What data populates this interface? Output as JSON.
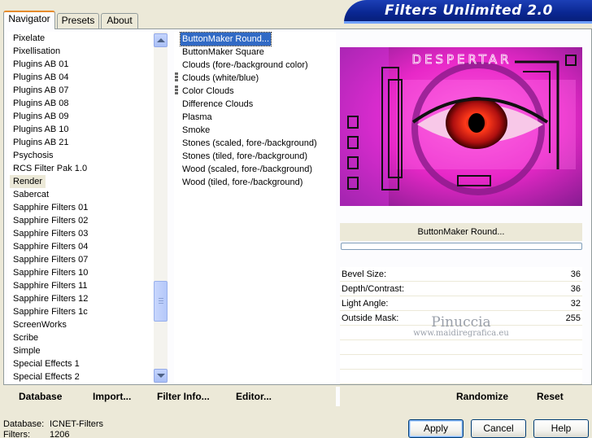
{
  "tabs": [
    "Navigator",
    "Presets",
    "About"
  ],
  "app_title": "Filters Unlimited 2.0",
  "categories": [
    "Pixelate",
    "Pixellisation",
    "Plugins AB 01",
    "Plugins AB 04",
    "Plugins AB 07",
    "Plugins AB 08",
    "Plugins AB 09",
    "Plugins AB 10",
    "Plugins AB 21",
    "Psychosis",
    "RCS Filter Pak 1.0",
    "Render",
    "Sabercat",
    "Sapphire Filters 01",
    "Sapphire Filters 02",
    "Sapphire Filters 03",
    "Sapphire Filters 04",
    "Sapphire Filters 07",
    "Sapphire Filters 10",
    "Sapphire Filters 11",
    "Sapphire Filters 12",
    "Sapphire Filters 1c",
    "ScreenWorks",
    "Scribe",
    "Simple",
    "Special Effects 1",
    "Special Effects 2"
  ],
  "selected_category": "Render",
  "filters": [
    "ButtonMaker Round...",
    "ButtonMaker Square",
    "Clouds (fore-/background color)",
    "Clouds (white/blue)",
    "Color Clouds",
    "Difference Clouds",
    "Plasma",
    "Smoke",
    "Stones (scaled, fore-/background)",
    "Stones (tiled, fore-/background)",
    "Wood (scaled, fore-/background)",
    "Wood (tiled, fore-/background)"
  ],
  "selected_filter": "ButtonMaker Round...",
  "preview": {
    "text_top": "DESPERTAR"
  },
  "filter_name": "ButtonMaker Round...",
  "params": [
    {
      "label": "Bevel Size:",
      "value": "36"
    },
    {
      "label": "Depth/Contrast:",
      "value": "36"
    },
    {
      "label": "Light Angle:",
      "value": "32"
    },
    {
      "label": "Outside Mask:",
      "value": "255"
    }
  ],
  "watermark": {
    "name": "Pinuccia",
    "url": "www.maidiregrafica.eu"
  },
  "toolbar": {
    "database": "Database",
    "import": "Import...",
    "filter_info": "Filter Info...",
    "editor": "Editor...",
    "randomize": "Randomize",
    "reset": "Reset"
  },
  "status": {
    "database_label": "Database:",
    "database_value": "ICNET-Filters",
    "filters_label": "Filters:",
    "filters_value": "1206"
  },
  "buttons": {
    "apply": "Apply",
    "cancel": "Cancel",
    "help": "Help"
  }
}
